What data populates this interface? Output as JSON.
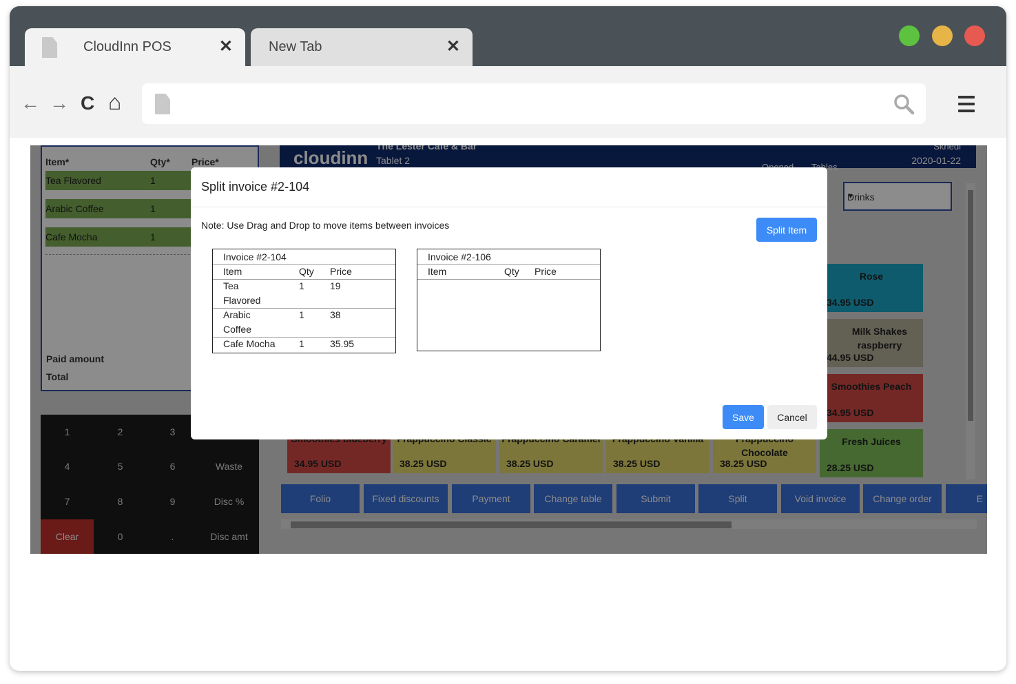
{
  "browser": {
    "tabs": [
      {
        "title": "CloudInn POS",
        "close": "✕"
      },
      {
        "title": "New Tab",
        "close": "✕"
      }
    ],
    "nav": {
      "back": "←",
      "forward": "→",
      "reload": "C",
      "home": "⌂"
    }
  },
  "pos": {
    "order_panel": {
      "headers": {
        "item": "Item*",
        "qty": "Qty*",
        "price": "Price*"
      },
      "rows": [
        {
          "item": "Tea Flavored",
          "qty": "1"
        },
        {
          "item": "Arabic Coffee",
          "qty": "1"
        },
        {
          "item": "Cafe Mocha",
          "qty": "1"
        }
      ],
      "paid_label": "Paid amount",
      "total_label": "Total"
    },
    "keypad": [
      "1",
      "2",
      "3",
      "",
      "4",
      "5",
      "6",
      "Waste",
      "7",
      "8",
      "9",
      "Disc %",
      "Clear",
      "0",
      ".",
      "Disc amt"
    ],
    "header": {
      "logo": "cloudinn",
      "venue": "The Lester Cafe & Bar",
      "tablet": "Tablet 2",
      "opened": "Opened",
      "tables": "Tables",
      "shift": "Skhedl",
      "date": "2020-01-22"
    },
    "category_select": "Drinks",
    "tiles_right": [
      {
        "name": "Rose",
        "price": "34.95 USD",
        "color": "#1aa7c9"
      },
      {
        "name": "Milk Shakes raspberry",
        "price": "44.95 USD",
        "color": "#b5b09a"
      },
      {
        "name": "Smoothies Peach",
        "price": "34.95 USD",
        "color": "#d44a45"
      },
      {
        "name": "Fresh Juices",
        "price": "28.25 USD",
        "color": "#7ec05a"
      }
    ],
    "tiles_bottom": [
      {
        "name": "Smoothies blueberry",
        "price": "34.95 USD",
        "color": "#d44a45"
      },
      {
        "name": "Frappuccino Classic",
        "price": "38.25 USD",
        "color": "#e2d86a"
      },
      {
        "name": "Frappuccino Caramel",
        "price": "38.25 USD",
        "color": "#e2d86a"
      },
      {
        "name": "Frappuccino Vanilla",
        "price": "38.25 USD",
        "color": "#e2d86a"
      },
      {
        "name": "Frappuccino Chocolate",
        "price": "38.25 USD",
        "color": "#e2d86a"
      }
    ],
    "actions": [
      "Folio",
      "Fixed discounts",
      "Payment",
      "Change table",
      "Submit",
      "Split",
      "Void invoice",
      "Change order",
      "E"
    ]
  },
  "modal": {
    "title": "Split invoice #2-104",
    "note": "Note: Use Drag and Drop to move items between invoices",
    "split_item": "Split Item",
    "save": "Save",
    "cancel": "Cancel",
    "invoice_a": {
      "title": "Invoice #2-104",
      "headers": {
        "item": "Item",
        "qty": "Qty",
        "price": "Price"
      },
      "rows": [
        {
          "item": "Tea Flavored",
          "qty": "1",
          "price": "19"
        },
        {
          "item": "Arabic Coffee",
          "qty": "1",
          "price": "38"
        },
        {
          "item": "Cafe Mocha",
          "qty": "1",
          "price": "35.95"
        }
      ]
    },
    "invoice_b": {
      "title": "Invoice #2-106",
      "headers": {
        "item": "Item",
        "qty": "Qty",
        "price": "Price"
      }
    }
  }
}
